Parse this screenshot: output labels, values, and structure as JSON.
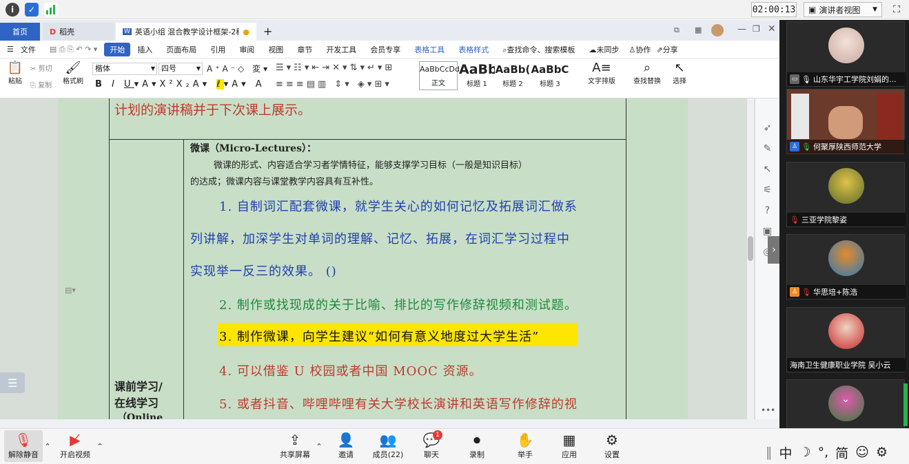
{
  "topbar": {
    "timer": "02:00:13",
    "speaker_view": "演讲者视图"
  },
  "wps": {
    "tabs": [
      {
        "label": "首页"
      },
      {
        "label": "稻壳"
      },
      {
        "label": "英语小组 混合教学设计框架-2稿"
      }
    ],
    "menu": [
      "文件",
      "开始",
      "插入",
      "页面布局",
      "引用",
      "审阅",
      "视图",
      "章节",
      "开发工具",
      "会员专享",
      "表格工具",
      "表格样式",
      "查找命令、搜索模板",
      "未同步",
      "协作",
      "分享"
    ],
    "ribbon": {
      "paste": "粘贴",
      "cut": "剪切",
      "copy": "复制",
      "format_painter": "格式刷",
      "font": "楷体",
      "size": "四号",
      "styles": [
        {
          "preview": "AaBbCcDd",
          "name": "正文"
        },
        {
          "preview": "AaBb",
          "name": "标题 1"
        },
        {
          "preview": "AaBb(",
          "name": "标题 2"
        },
        {
          "preview": "AaBbC",
          "name": "标题 3"
        }
      ],
      "text_layout": "文字排版",
      "find_replace": "查找替换",
      "select": "选择"
    }
  },
  "doc": {
    "top_text": "计划的演讲稿并于下次课上展示。",
    "left_cell": [
      "课前学习/",
      "在线学习",
      "（Online"
    ],
    "heading": "微课（Micro-Lectures）：",
    "desc1": "微课的形式、内容适合学习者学情特征，能够支撑学习目标（一般是知识目标）",
    "desc2": "的达成；微课内容与课堂教学内容具有互补性。",
    "item1": [
      "1. 自制词汇配套微课，就学生关心的如何记忆及拓展词汇做系",
      "列讲解，加深学生对单词的理解、记忆、拓展，在词汇学习过程中",
      "实现举一反三的效果。 ()"
    ],
    "item2": "2. 制作或找现成的关于比喻、排比的写作修辞视频和测试题。",
    "item3": "3. 制作微课，向学生建议“如何有意义地度过大学生活”",
    "item4": "4. 可以借鉴 U 校园或者中国 MOOC 资源。",
    "item5": "5. 或者抖音、哔哩哔哩有关大学校长演讲和英语写作修辞的视"
  },
  "participants": [
    {
      "name": "山东华宇工学院刘娟的..."
    },
    {
      "name": "何聚厚陕西师范大学"
    },
    {
      "name": "三亚学院黎姿"
    },
    {
      "name": "华思培+陈浩"
    },
    {
      "name": "海南卫生健康职业学院 吴小云"
    }
  ],
  "bottom": {
    "unmute": "解除静音",
    "video": "开启视频",
    "share": "共享屏幕",
    "invite": "邀请",
    "members": "成员(22)",
    "chat": "聊天",
    "chat_badge": "1",
    "record": "录制",
    "raise": "举手",
    "apps": "应用",
    "settings": "设置"
  },
  "ime": {
    "lang": "中",
    "mode": "简"
  },
  "colors": {
    "blue": "#1f3fb0",
    "green": "#1e8a3c",
    "red": "#c0392b",
    "highlight": "#ffe600"
  }
}
